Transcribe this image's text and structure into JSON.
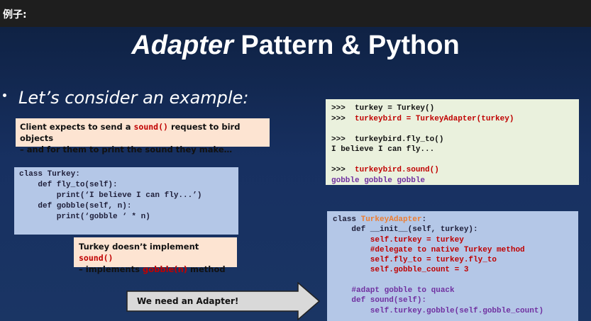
{
  "header": {
    "label": "例子:"
  },
  "slide": {
    "title_italic": "Adapter",
    "title_rest": " Pattern & Python",
    "bullet": "Let’s consider an example:"
  },
  "note_client": {
    "part1": "Client expects to send a ",
    "code": "sound()",
    "part2": "  request to bird objects",
    "line2": "– and for them to print the sound they make…"
  },
  "turkey_code": {
    "lines": [
      "class Turkey:",
      "    def fly_to(self):",
      "        print(‘I believe I can fly...’)",
      "",
      "    def gobble(self, n):",
      "        print(‘gobble ‘ * n)"
    ]
  },
  "note_turkey": {
    "part1": "Turkey doesn’t implement ",
    "code": "sound()",
    "line2_part1": "– implements ",
    "code2": "gobble(n)",
    "line2_part2": " method"
  },
  "console": {
    "l1_prompt": ">>>  ",
    "l1": "turkey = Turkey()",
    "l2_prompt": ">>>  ",
    "l2": "turkeybird = TurkeyAdapter(turkey)",
    "l3_prompt": ">>>  ",
    "l3": "turkeybird.fly_to()",
    "l4": "I believe I can fly...",
    "l5_prompt": ">>>  ",
    "l5": "turkeybird.sound()",
    "l6": "gobble gobble gobble"
  },
  "adapter_code": {
    "class_kw": "class ",
    "class_name": "TurkeyAdapter",
    "class_colon": ":",
    "init": "    def __init__(self, turkey):",
    "l1": "        self.turkey = turkey",
    "l2": "        #delegate to native Turkey method",
    "l3": "        self.fly_to = turkey.fly_to",
    "l4": "        self.gobble_count = 3",
    "l5": "    #adapt gobble to quack",
    "l6": "    def sound(self):",
    "l7": "        self.turkey.gobble(self.gobble_count)"
  },
  "arrow": {
    "label": "We need an Adapter!"
  },
  "colors": {
    "code_red": "#c00000",
    "code_purple": "#7030a0",
    "class_orange": "#ed7d31",
    "slide_bg": "#173061"
  }
}
